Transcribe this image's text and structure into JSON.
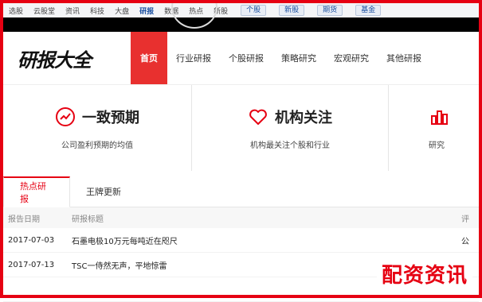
{
  "portal_nav": {
    "items": [
      "选股",
      "云股堂",
      "资讯",
      "科技",
      "大盘",
      "研报",
      "数据",
      "热点",
      "新股"
    ],
    "active_index": 5,
    "buttons": [
      "个股",
      "新股",
      "期货",
      "基金"
    ]
  },
  "site": {
    "logo": "研报大全",
    "nav": [
      "首页",
      "行业研报",
      "个股研报",
      "策略研究",
      "宏观研究",
      "其他研报"
    ],
    "active_nav_index": 0
  },
  "features": [
    {
      "title": "一致预期",
      "subtitle": "公司盈利预期的均值",
      "icon": "trend-circle-icon"
    },
    {
      "title": "机构关注",
      "subtitle": "机构最关注个股和行业",
      "icon": "heart-icon"
    },
    {
      "title": "",
      "subtitle": "研究",
      "icon": "bar-chart-icon"
    }
  ],
  "tabs": {
    "items": [
      "热点研报",
      "王牌更新"
    ],
    "active_index": 0
  },
  "table": {
    "headers": [
      "报告日期",
      "研报标题",
      "评"
    ],
    "rows": [
      {
        "date": "2017-07-03",
        "title": "石墨电极10万元每吨近在咫尺",
        "extra": "公"
      },
      {
        "date": "2017-07-13",
        "title": "TSC一侍然无声，平地惊雷",
        "extra": "公"
      },
      {
        "date": "",
        "title": "",
        "extra": ""
      }
    ]
  },
  "watermark": "配资资讯",
  "colors": {
    "brand_red": "#e60012",
    "nav_active": "#e8302f"
  }
}
